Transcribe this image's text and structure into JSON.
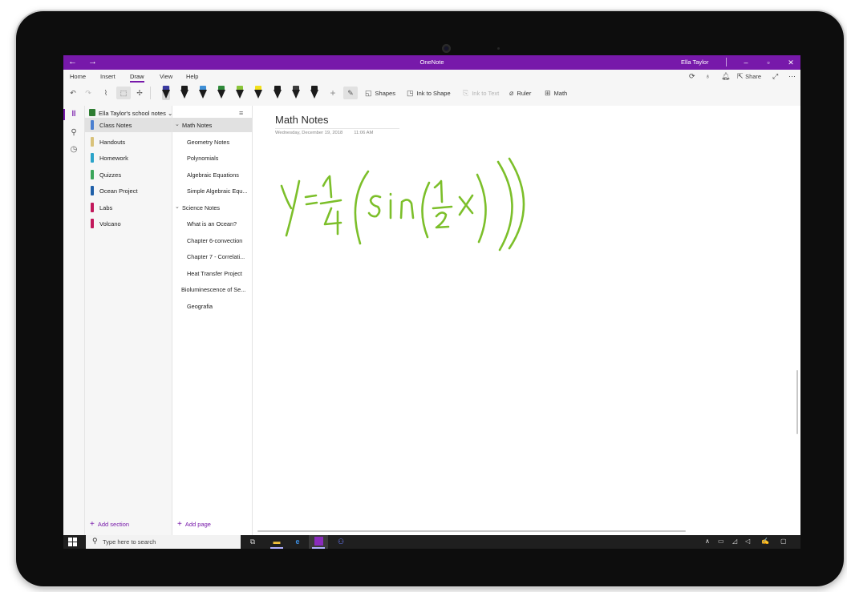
{
  "window": {
    "title": "OneNote",
    "user": "Ella Taylor",
    "back": "←",
    "forward": "→",
    "minimize": "–",
    "restore": "▫",
    "close": "✕"
  },
  "ribbon": {
    "tabs": [
      "Home",
      "Insert",
      "Draw",
      "View",
      "Help"
    ],
    "active_tab": "Draw",
    "share_label": "Share",
    "commands": {
      "shapes": "Shapes",
      "ink_to_shape": "Ink to Shape",
      "ink_to_text": "Ink to Text",
      "ruler": "Ruler",
      "math": "Math"
    },
    "pen_colors": [
      "#3b3ba0",
      "#1b1b1b",
      "#3f8fd6",
      "#2f8a3a",
      "#8ac53a",
      "#f2e01c",
      "#1b1b1b",
      "#3b3b3b",
      "#1b1b1b",
      "#2e2e2e"
    ]
  },
  "notebook": {
    "name": "Ella Taylor's school notes",
    "sections": [
      {
        "label": "Class Notes",
        "color": "#4a7fd0"
      },
      {
        "label": "Handouts",
        "color": "#d9c27a"
      },
      {
        "label": "Homework",
        "color": "#2aa3c9"
      },
      {
        "label": "Quizzes",
        "color": "#3aa55a"
      },
      {
        "label": "Ocean Project",
        "color": "#1f5fa8"
      },
      {
        "label": "Labs",
        "color": "#c2185b"
      },
      {
        "label": "Volcano",
        "color": "#c2185b"
      }
    ],
    "add_section": "Add section"
  },
  "pages": {
    "items": [
      {
        "label": "Math Notes",
        "kind": "group"
      },
      {
        "label": "Geometry Notes",
        "kind": "sub"
      },
      {
        "label": "Polynomials",
        "kind": "sub"
      },
      {
        "label": "Algebraic Equations",
        "kind": "sub"
      },
      {
        "label": "Simple Algebraic Equ...",
        "kind": "sub"
      },
      {
        "label": "Science Notes",
        "kind": "group"
      },
      {
        "label": "What is an Ocean?",
        "kind": "sub"
      },
      {
        "label": "Chapter 6-convection",
        "kind": "sub"
      },
      {
        "label": "Chapter 7 - Correlati...",
        "kind": "sub"
      },
      {
        "label": "Heat Transfer Project",
        "kind": "sub"
      },
      {
        "label": "Bioluminescence of Se...",
        "kind": "lvl0"
      },
      {
        "label": "Geografia",
        "kind": "sub"
      }
    ],
    "add_page": "Add page"
  },
  "page": {
    "title": "Math Notes",
    "date": "Wednesday, December 19, 2018",
    "time": "11:06 AM",
    "ink_color": "#7cbf2a"
  },
  "taskbar": {
    "search_placeholder": "Type here to search"
  }
}
